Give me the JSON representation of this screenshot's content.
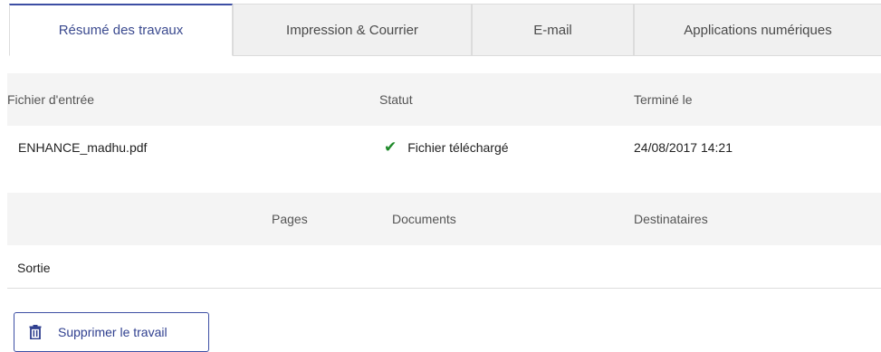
{
  "tabs": [
    {
      "label": "Résumé des travaux",
      "active": true
    },
    {
      "label": "Impression & Courrier",
      "active": false
    },
    {
      "label": "E-mail",
      "active": false
    },
    {
      "label": "Applications numériques",
      "active": false
    }
  ],
  "files_table": {
    "headers": {
      "input_file": "Fichier d'entrée",
      "status": "Statut",
      "completed": "Terminé le"
    },
    "row": {
      "input_file": "ENHANCE_madhu.pdf",
      "status": "Fichier téléchargé",
      "status_icon": "check-icon",
      "completed": "24/08/2017 14:21"
    }
  },
  "output_table": {
    "headers": {
      "pages": "Pages",
      "documents": "Documents",
      "recipients": "Destinataires"
    },
    "row": {
      "label": "Sortie"
    }
  },
  "actions": {
    "delete_label": "Supprimer le travail",
    "delete_icon": "trash-icon"
  },
  "colors": {
    "accent": "#3d4fa4",
    "success": "#1f8a2a",
    "header_bg": "#f4f4f4"
  }
}
